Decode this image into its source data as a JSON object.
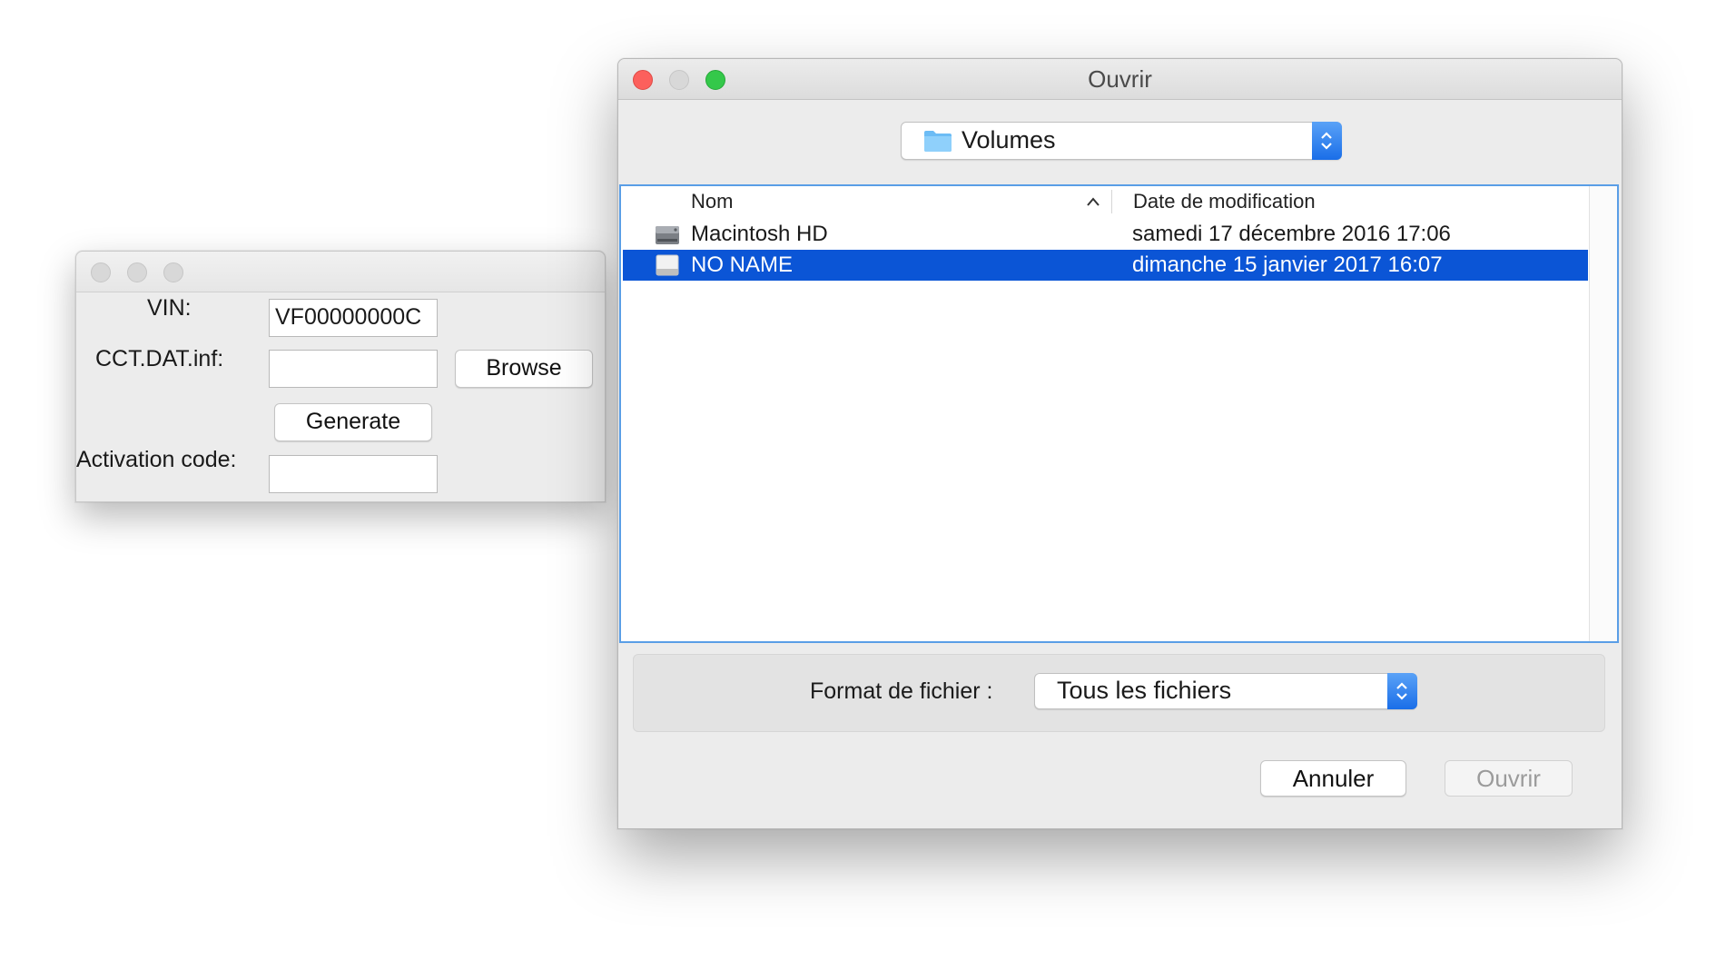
{
  "activation_window": {
    "vin_label": "VIN:",
    "vin_value": "VF00000000C",
    "cct_label": "CCT.DAT.inf:",
    "cct_value": "",
    "browse_label": "Browse",
    "generate_label": "Generate",
    "activation_label": "Activation code:",
    "activation_value": ""
  },
  "open_dialog": {
    "title": "Ouvrir",
    "location": "Volumes",
    "columns": {
      "name": "Nom",
      "date": "Date de modification"
    },
    "files": [
      {
        "name": "Macintosh HD",
        "date": "samedi 17 décembre 2016 17:06",
        "icon": "hard-disk-icon",
        "selected": false
      },
      {
        "name": "NO NAME",
        "date": "dimanche 15 janvier 2017 16:07",
        "icon": "removable-disk-icon",
        "selected": true
      }
    ],
    "format_label": "Format de fichier :",
    "format_value": "Tous les fichiers",
    "cancel_label": "Annuler",
    "open_label": "Ouvrir"
  },
  "colors": {
    "selection": "#0b55d6",
    "accent": "#1a6ee8",
    "close": "#fc605c",
    "minimize": "#d0d0d0",
    "zoom": "#34c84a"
  }
}
